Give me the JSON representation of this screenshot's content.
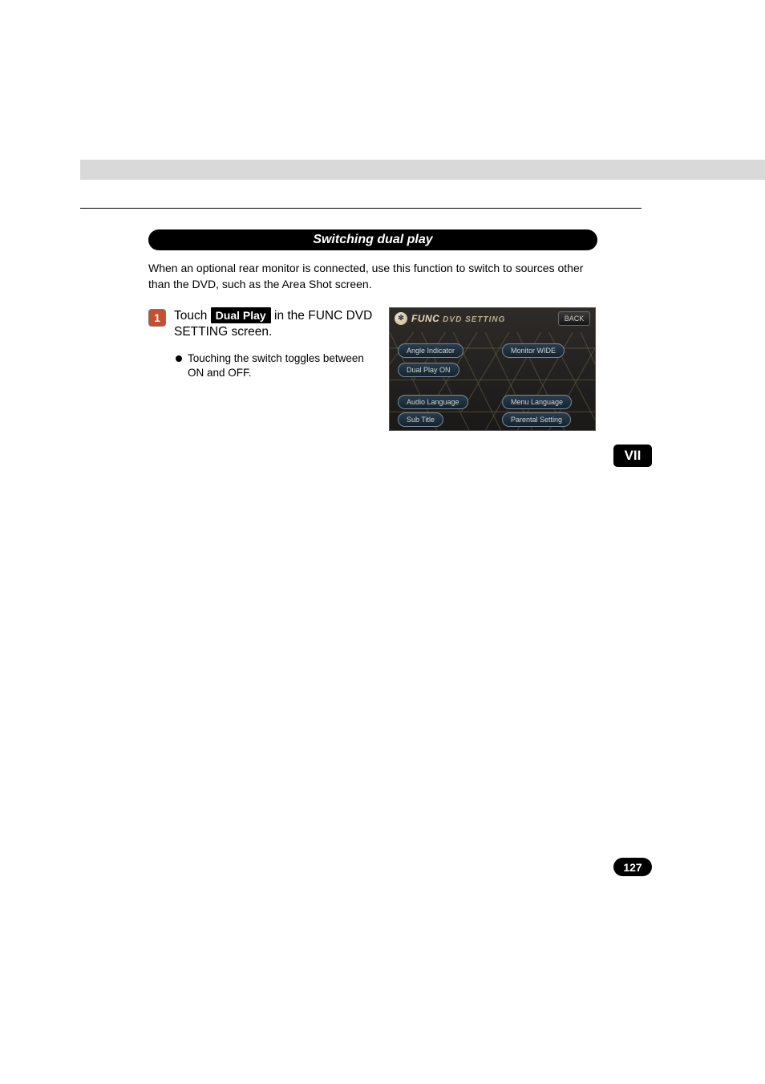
{
  "heading": "Switching dual play",
  "intro": "When an optional rear monitor is connected, use this function to switch to sources other than the DVD, such as the Area Shot screen.",
  "step": {
    "num": "1",
    "pre": "Touch ",
    "button": "Dual Play",
    "post": " in the FUNC DVD SETTING screen."
  },
  "bullet": "Touching the switch toggles between ON and OFF.",
  "screenshot": {
    "icon_glyph": "✻",
    "title_main": "FUNC",
    "title_sub": "DVD SETTING",
    "back": "BACK",
    "buttons": {
      "angle": "Angle Indicator",
      "monitor": "Monitor  WIDE",
      "dual": "Dual Play  ON",
      "audiolang": "Audio Language",
      "menulang": "Menu Language",
      "subtitle": "Sub Title",
      "parental": "Parental Setting"
    }
  },
  "section_tab": "VII",
  "page_number": "127"
}
